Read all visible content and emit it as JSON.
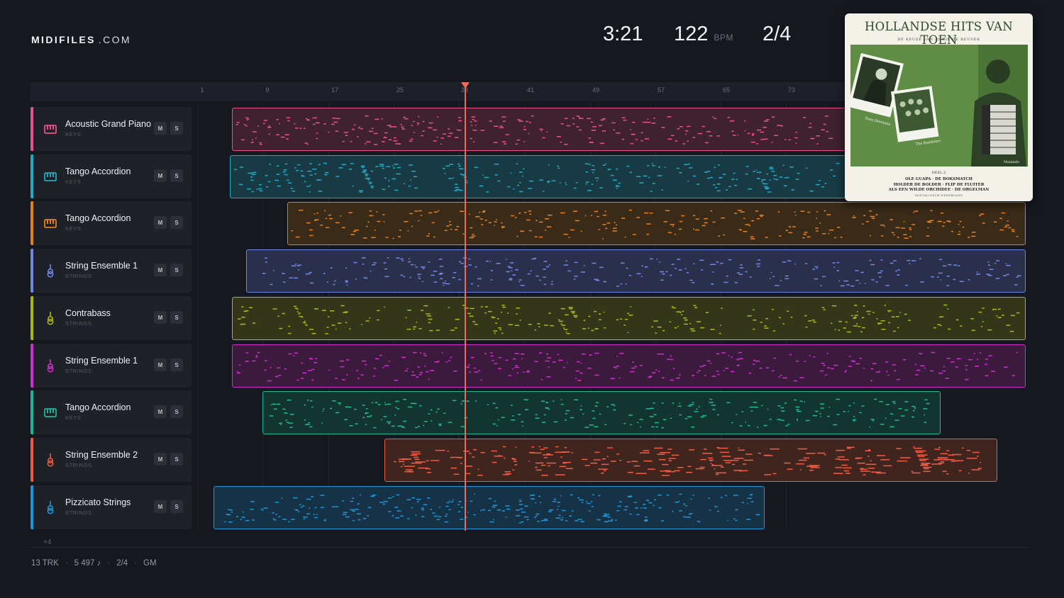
{
  "app": {
    "logo_main": "MIDIFILES",
    "logo_domain": ".COM"
  },
  "transport": {
    "time": "3:21",
    "bpm": "122",
    "bpm_unit": "BPM",
    "meter": "2/4"
  },
  "ruler": {
    "ticks": [
      "1",
      "9",
      "17",
      "25",
      "33",
      "41",
      "49",
      "57",
      "65",
      "73"
    ]
  },
  "tracks": [
    {
      "name": "Acoustic Grand Piano",
      "category": "KEYS",
      "icon": "piano-icon",
      "color": "#e8508c",
      "mute": "M",
      "solo": "S"
    },
    {
      "name": "Tango Accordion",
      "category": "KEYS",
      "icon": "piano-icon",
      "color": "#22a9c2",
      "mute": "M",
      "solo": "S"
    },
    {
      "name": "Tango Accordion",
      "category": "KEYS",
      "icon": "piano-icon",
      "color": "#e47f1f",
      "mute": "M",
      "solo": "S"
    },
    {
      "name": "String Ensemble 1",
      "category": "STRINGS",
      "icon": "guitar-icon",
      "color": "#6f86e6",
      "mute": "M",
      "solo": "S"
    },
    {
      "name": "Contrabass",
      "category": "STRINGS",
      "icon": "guitar-icon",
      "color": "#a9b717",
      "mute": "M",
      "solo": "S"
    },
    {
      "name": "String Ensemble 1",
      "category": "STRINGS",
      "icon": "guitar-icon",
      "color": "#cf2ccd",
      "mute": "M",
      "solo": "S"
    },
    {
      "name": "Tango Accordion",
      "category": "KEYS",
      "icon": "piano-icon",
      "color": "#1fb597",
      "mute": "M",
      "solo": "S"
    },
    {
      "name": "String Ensemble 2",
      "category": "STRINGS",
      "icon": "guitar-icon",
      "color": "#ef5a43",
      "mute": "M",
      "solo": "S"
    },
    {
      "name": "Pizzicato Strings",
      "category": "STRINGS",
      "icon": "guitar-icon",
      "color": "#1c95d6",
      "mute": "M",
      "solo": "S"
    }
  ],
  "more_tracks": "+4",
  "footer": {
    "tracks": "13 TRK",
    "notes": "5 497 ♪",
    "meter": "2/4",
    "standard": "GM"
  },
  "album": {
    "title": "HOLLANDSE HITS VAN TOEN",
    "subtitle": "DE KEUZE VAN ANNIE DE REUVER",
    "part": "DEEL 2",
    "songs_line1": "OLE GUAPA · DE BOKSMATCH",
    "songs_line2": "HOLDER DE BOLDER · FLIP DE FLUITER",
    "songs_line3": "ALS EEN WILDE ORCHIDEE · DE ORGELMAN",
    "series": "NOSTALGISCH NEDERLAND",
    "caption_left": "Toon Hermans",
    "caption_mid": "The Ramblers",
    "caption_right": "Malando"
  }
}
